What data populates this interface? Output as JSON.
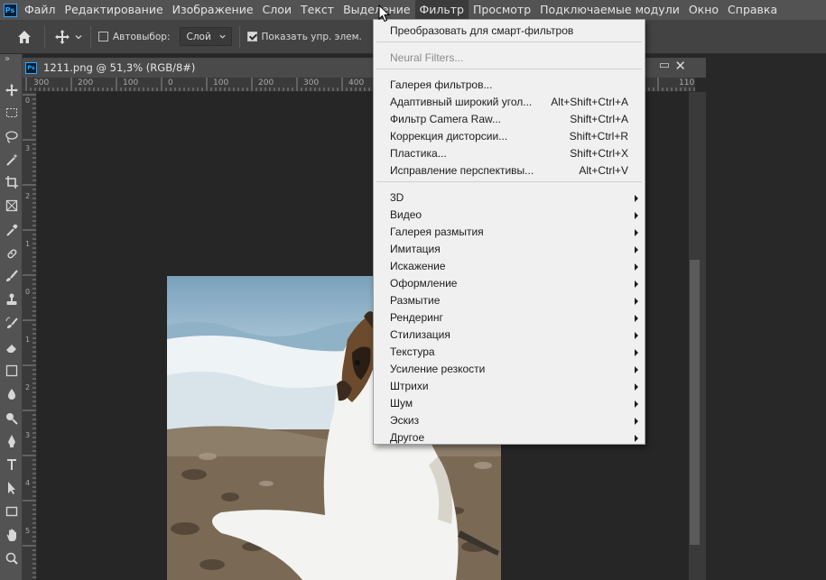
{
  "menubar": {
    "items": [
      "Файл",
      "Редактирование",
      "Изображение",
      "Слои",
      "Текст",
      "Выделение",
      "Фильтр",
      "Просмотр",
      "Подключаемые модули",
      "Окно",
      "Справка"
    ],
    "active_index": 6
  },
  "options": {
    "autoselect_label": "Автовыбор:",
    "autoselect_checked": false,
    "layer_select_value": "Слой",
    "show_controls_label": "Показать упр. элем.",
    "show_controls_checked": true
  },
  "document": {
    "tab_title": "1211.png @ 51,3% (RGB/8#)"
  },
  "ruler": {
    "top_labels": [
      "300",
      "200",
      "100",
      "0",
      "100",
      "200",
      "300",
      "400"
    ],
    "right_label": "110",
    "left_labels": [
      "0",
      "3",
      "2",
      "1",
      "0",
      "1",
      "2",
      "3",
      "4",
      "5"
    ]
  },
  "filter_menu": {
    "items": [
      {
        "label": "Преобразовать для смарт-фильтров",
        "shortcut": "",
        "submenu": false,
        "disabled": false
      },
      {
        "label": "Neural Filters...",
        "shortcut": "",
        "submenu": false,
        "disabled": true
      },
      {
        "label": "Галерея фильтров...",
        "shortcut": "",
        "submenu": false,
        "disabled": false
      },
      {
        "label": "Адаптивный широкий угол...",
        "shortcut": "Alt+Shift+Ctrl+A",
        "submenu": false,
        "disabled": false
      },
      {
        "label": "Фильтр Camera Raw...",
        "shortcut": "Shift+Ctrl+A",
        "submenu": false,
        "disabled": false
      },
      {
        "label": "Коррекция дисторсии...",
        "shortcut": "Shift+Ctrl+R",
        "submenu": false,
        "disabled": false
      },
      {
        "label": "Пластика...",
        "shortcut": "Shift+Ctrl+X",
        "submenu": false,
        "disabled": false
      },
      {
        "label": "Исправление перспективы...",
        "shortcut": "Alt+Ctrl+V",
        "submenu": false,
        "disabled": false
      },
      {
        "label": "3D",
        "shortcut": "",
        "submenu": true,
        "disabled": false
      },
      {
        "label": "Видео",
        "shortcut": "",
        "submenu": true,
        "disabled": false
      },
      {
        "label": "Галерея размытия",
        "shortcut": "",
        "submenu": true,
        "disabled": false
      },
      {
        "label": "Имитация",
        "shortcut": "",
        "submenu": true,
        "disabled": false
      },
      {
        "label": "Искажение",
        "shortcut": "",
        "submenu": true,
        "disabled": false
      },
      {
        "label": "Оформление",
        "shortcut": "",
        "submenu": true,
        "disabled": false
      },
      {
        "label": "Размытие",
        "shortcut": "",
        "submenu": true,
        "disabled": false
      },
      {
        "label": "Рендеринг",
        "shortcut": "",
        "submenu": true,
        "disabled": false
      },
      {
        "label": "Стилизация",
        "shortcut": "",
        "submenu": true,
        "disabled": false
      },
      {
        "label": "Текстура",
        "shortcut": "",
        "submenu": true,
        "disabled": false
      },
      {
        "label": "Усиление резкости",
        "shortcut": "",
        "submenu": true,
        "disabled": false
      },
      {
        "label": "Штрихи",
        "shortcut": "",
        "submenu": true,
        "disabled": false
      },
      {
        "label": "Шум",
        "shortcut": "",
        "submenu": true,
        "disabled": false
      },
      {
        "label": "Эскиз",
        "shortcut": "",
        "submenu": true,
        "disabled": false
      },
      {
        "label": "Другое",
        "shortcut": "",
        "submenu": true,
        "disabled": false
      }
    ]
  },
  "tools": [
    "move-tool",
    "marquee-tool",
    "lasso-tool",
    "magic-wand-tool",
    "crop-tool",
    "frame-tool",
    "eyedropper-tool",
    "healing-brush-tool",
    "brush-tool",
    "clone-stamp-tool",
    "history-brush-tool",
    "eraser-tool",
    "gradient-tool",
    "blur-tool",
    "dodge-tool",
    "pen-tool",
    "type-tool",
    "path-selection-tool",
    "rectangle-tool",
    "hand-tool",
    "zoom-tool"
  ],
  "colors": {
    "menubar_bg": "#535353",
    "menu_dropdown_bg": "#f0f0f0",
    "panel_bg": "#282828",
    "ps_blue": "#31a8ff"
  }
}
